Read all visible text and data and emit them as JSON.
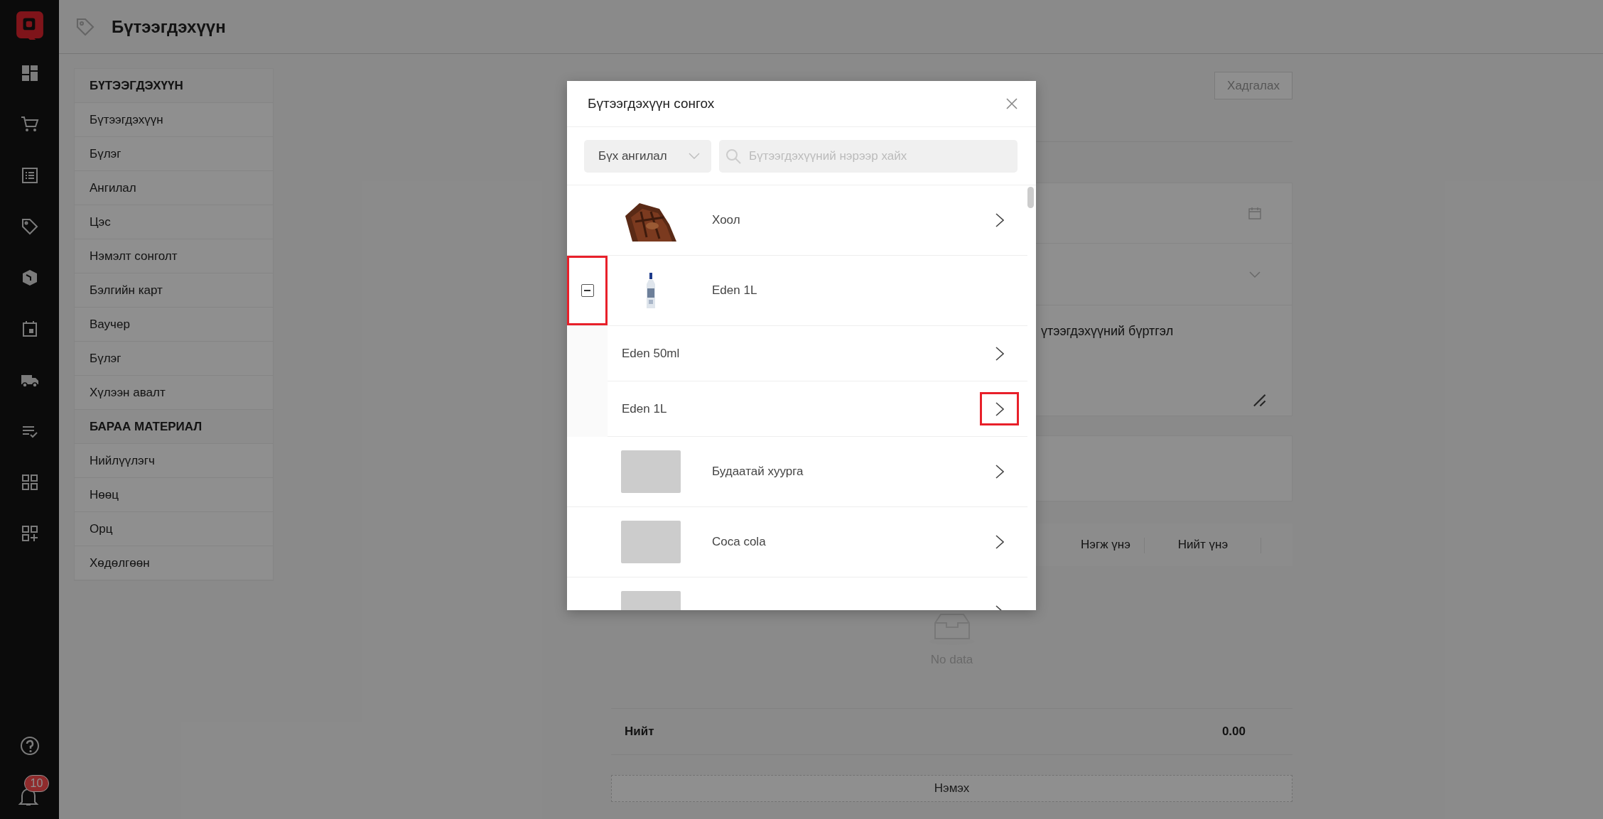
{
  "rail": {
    "badge": "10"
  },
  "header": {
    "title": "Бүтээгдэхүүн"
  },
  "submenu": {
    "sections": [
      {
        "title": "БҮТЭЭГДЭХҮҮН",
        "items": [
          "Бүтээгдэхүүн",
          "Бүлэг",
          "Ангилал",
          "Цэс",
          "Нэмэлт сонголт",
          "Бэлгийн карт",
          "Ваучер",
          "Бүлэг",
          "Хүлээн авалт"
        ]
      },
      {
        "title": "БАРАА МАТЕРИАЛ",
        "items": [
          "Нийлүүлэгч",
          "Нөөц",
          "Орц",
          "Хөдөлгөөн"
        ]
      }
    ]
  },
  "page": {
    "save_button": "Хадгалах",
    "note_field": {
      "value": "үтээгдэхүүний бүртгэл"
    },
    "table": {
      "columns": [
        "Нэгж үнэ",
        "Нийт үнэ"
      ],
      "empty_text": "No data",
      "total_label": "Нийт",
      "total_value": "0.00"
    },
    "add_button": "Нэмэх"
  },
  "modal": {
    "title": "Бүтээгдэхүүн сонгох",
    "category_select": {
      "value": "Бүх ангилал"
    },
    "search": {
      "placeholder": "Бүтээгдэхүүний нэрээр хайх"
    },
    "items": [
      {
        "name": "Хоол",
        "kind": "picture",
        "expanded": false,
        "partially_checked": false,
        "highlighted": false
      },
      {
        "name": "Eden 1L",
        "kind": "picture",
        "expanded": true,
        "partially_checked": true,
        "highlighted": true,
        "children": [
          {
            "name": "Eden 50ml",
            "highlighted": false
          },
          {
            "name": "Eden 1L",
            "highlighted": true
          }
        ]
      },
      {
        "name": "Будаатай хуурга",
        "kind": "placeholder",
        "expanded": false,
        "partially_checked": false,
        "highlighted": false
      },
      {
        "name": "Coca cola",
        "kind": "placeholder",
        "expanded": false,
        "partially_checked": false,
        "highlighted": false
      },
      {
        "kind": "placeholder",
        "expanded": false,
        "partially_checked": false,
        "highlighted": false
      }
    ]
  }
}
